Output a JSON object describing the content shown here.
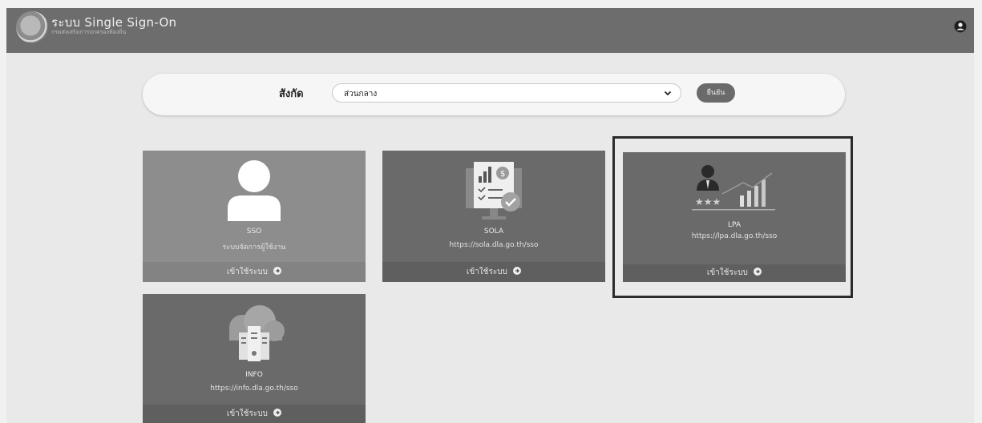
{
  "header": {
    "title": "ระบบ Single Sign-On",
    "subtitle": "กรมส่งเสริมการปกครองท้องถิ่น",
    "user_icon": "user-circle-icon"
  },
  "filter": {
    "label": "สังกัด",
    "selected": "ส่วนกลาง",
    "confirm_label": "ยืนยัน"
  },
  "systems": [
    {
      "name": "SSO",
      "description": "ระบบจัดการผู้ใช้งาน",
      "link_label": "เข้าใช้ระบบ",
      "icon": "user-silhouette-icon"
    },
    {
      "name": "SOLA",
      "description": "https://sola.dla.go.th/sso",
      "link_label": "เข้าใช้ระบบ",
      "icon": "report-checklist-icon"
    },
    {
      "name": "LPA",
      "description": "https://lpa.dla.go.th/sso",
      "link_label": "เข้าใช้ระบบ",
      "icon": "performance-rating-icon"
    },
    {
      "name": "INFO",
      "description": "https://info.dla.go.th/sso",
      "link_label": "เข้าใช้ระบบ",
      "icon": "cloud-server-icon"
    }
  ]
}
